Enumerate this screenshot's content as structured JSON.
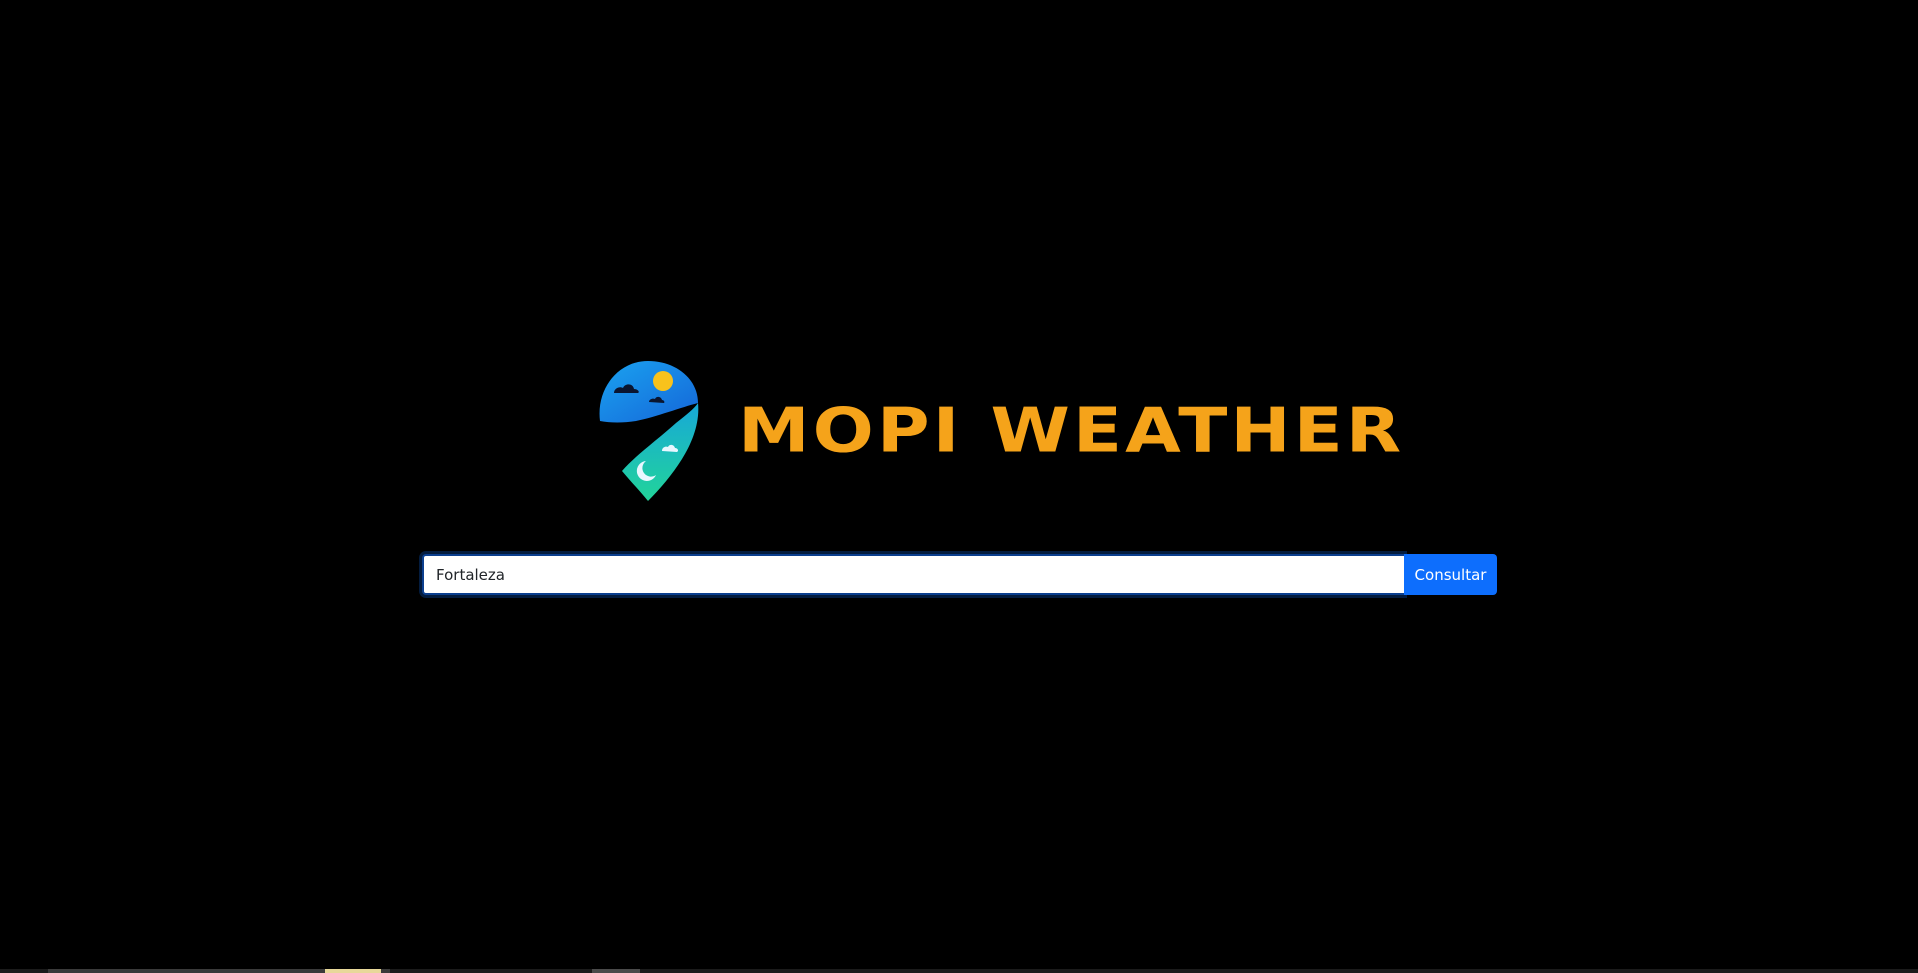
{
  "brand": {
    "title": "MOPI WEATHER",
    "logo_icon": "location-pin-day-night-icon",
    "title_color": "#f5a31a"
  },
  "search": {
    "value": "Fortaleza",
    "button_label": "Consultar",
    "button_color": "#0d6efd"
  },
  "colors": {
    "background": "#000000",
    "pin_blue": "#1e88e5",
    "pin_teal": "#1ec9a4",
    "sun": "#f8c21c"
  }
}
